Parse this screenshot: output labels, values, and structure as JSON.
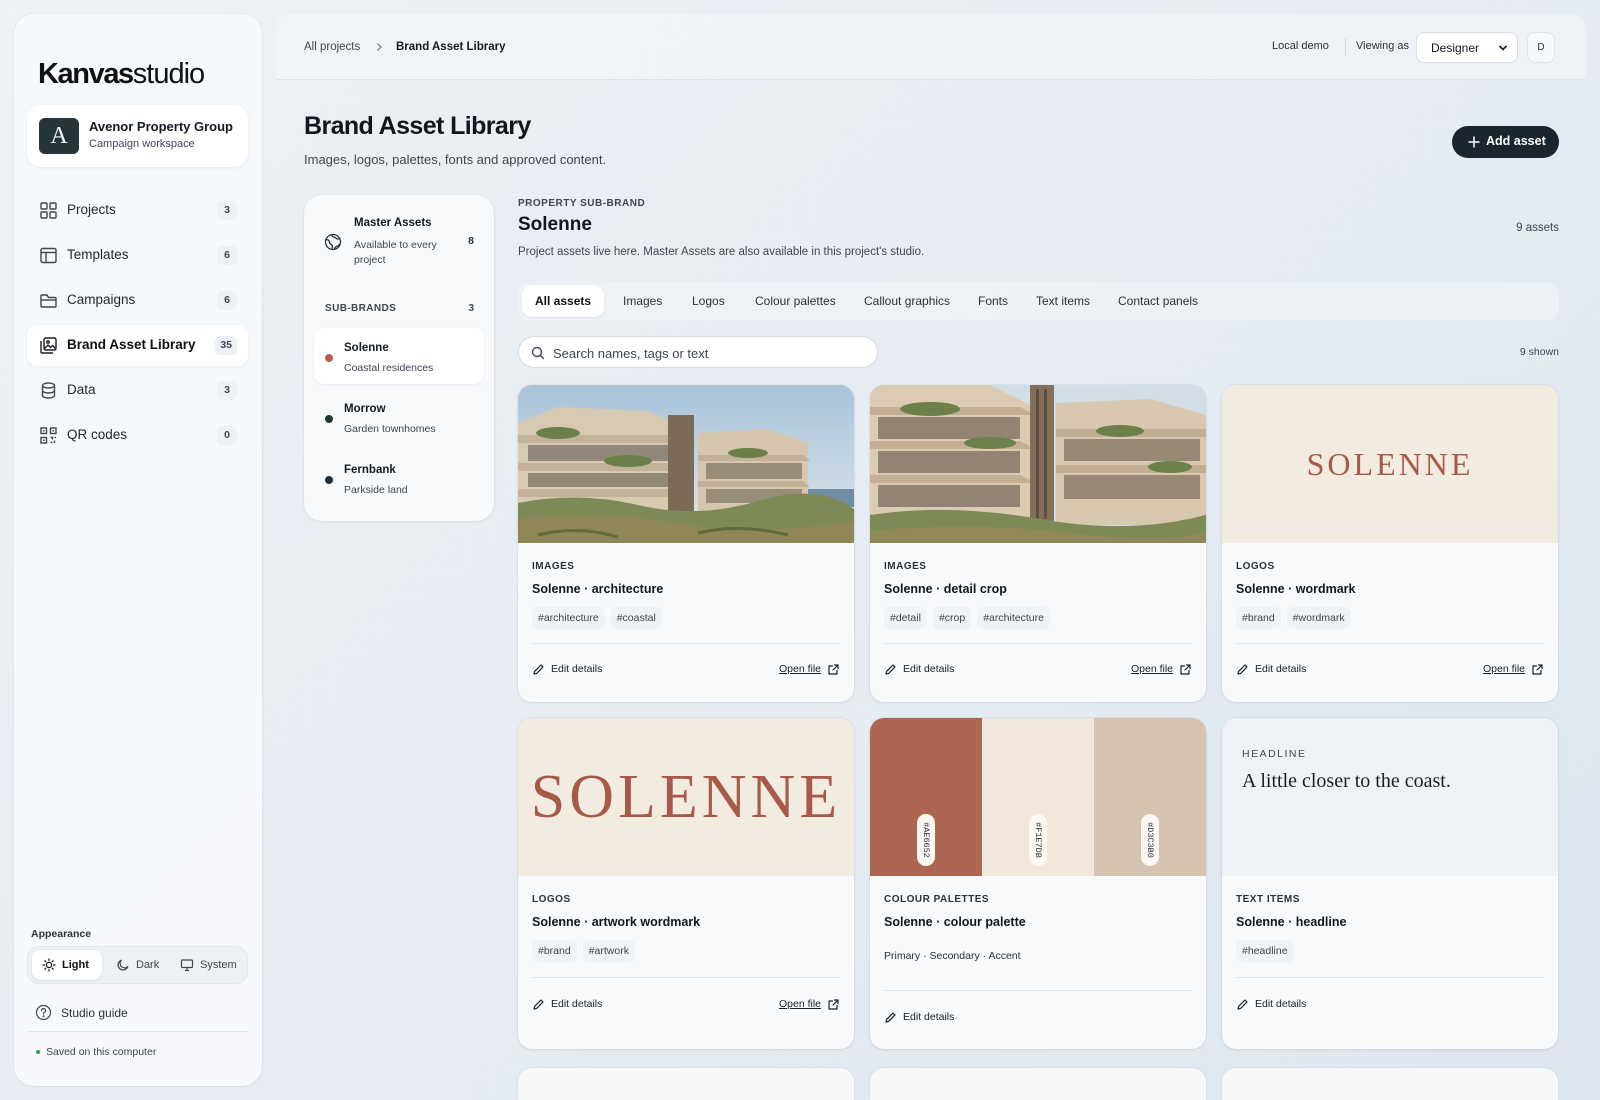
{
  "app": {
    "logo_bold": "Kanvas",
    "logo_light": "studio"
  },
  "workspace": {
    "avatar": "A",
    "name": "Avenor Property Group",
    "subtitle": "Campaign workspace"
  },
  "sidebar": {
    "items": [
      {
        "label": "Projects",
        "count": "3",
        "icon": "grid-icon"
      },
      {
        "label": "Templates",
        "count": "6",
        "icon": "layout-icon"
      },
      {
        "label": "Campaigns",
        "count": "6",
        "icon": "folder-icon"
      },
      {
        "label": "Brand Asset Library",
        "count": "35",
        "icon": "image-library-icon",
        "active": true
      },
      {
        "label": "Data",
        "count": "3",
        "icon": "database-icon"
      },
      {
        "label": "QR codes",
        "count": "0",
        "icon": "qr-code-icon"
      }
    ],
    "appearance_label": "Appearance",
    "themes": [
      "Light",
      "Dark",
      "System"
    ],
    "active_theme": "Light",
    "guide": "Studio guide",
    "saved": "Saved on this computer"
  },
  "topbar": {
    "breadcrumb_root": "All projects",
    "breadcrumb_current": "Brand Asset Library",
    "mode": "Local demo",
    "viewing_label": "Viewing as",
    "role": "Designer",
    "user_initial": "D"
  },
  "page": {
    "title": "Brand Asset Library",
    "subtitle": "Images, logos, palettes, fonts and approved content.",
    "add_button": "Add asset"
  },
  "brand_panel": {
    "master_title": "Master Assets",
    "master_subtitle": "Available to every project",
    "master_count": "8",
    "sub_brands_label": "SUB-BRANDS",
    "sub_brands_count": "3",
    "sub_brands": [
      {
        "name": "Solenne",
        "subtitle": "Coastal residences",
        "color": "#B5604E",
        "active": true
      },
      {
        "name": "Morrow",
        "subtitle": "Garden townhomes",
        "color": "#1E3A2E"
      },
      {
        "name": "Fernbank",
        "subtitle": "Parkside land",
        "color": "#1F2E38"
      }
    ]
  },
  "main": {
    "eyebrow": "PROPERTY SUB-BRAND",
    "title": "Solenne",
    "asset_count": "9 assets",
    "description": "Project assets live here. Master Assets are also available in this project's studio.",
    "tabs": [
      "All assets",
      "Images",
      "Logos",
      "Colour palettes",
      "Callout graphics",
      "Fonts",
      "Text items",
      "Contact panels"
    ],
    "active_tab": "All assets",
    "search_placeholder": "Search names, tags or text",
    "shown_count": "9 shown"
  },
  "assets": [
    {
      "category": "IMAGES",
      "title": "Solenne · architecture",
      "tags": [
        "#architecture",
        "#coastal"
      ],
      "edit": "Edit details",
      "open": "Open file"
    },
    {
      "category": "IMAGES",
      "title": "Solenne · detail crop",
      "tags": [
        "#detail",
        "#crop",
        "#architecture"
      ],
      "edit": "Edit details",
      "open": "Open file"
    },
    {
      "category": "LOGOS",
      "title": "Solenne · wordmark",
      "tags": [
        "#brand",
        "#wordmark"
      ],
      "edit": "Edit details",
      "open": "Open file",
      "logo_text": "SOLENNE"
    },
    {
      "category": "LOGOS",
      "title": "Solenne · artwork wordmark",
      "tags": [
        "#brand",
        "#artwork"
      ],
      "edit": "Edit details",
      "open": "Open file",
      "logo_text": "SOLENNE"
    },
    {
      "category": "COLOUR PALETTES",
      "title": "Solenne · colour palette",
      "subtitle": "Primary · Secondary · Accent",
      "edit": "Edit details",
      "swatches": [
        "#AE6652",
        "#F1E7DB",
        "#D3C3B0"
      ]
    },
    {
      "category": "TEXT ITEMS",
      "title": "Solenne · headline",
      "tags": [
        "#headline"
      ],
      "edit": "Edit details",
      "headline_label": "HEADLINE",
      "headline_text": "A little closer to the coast."
    }
  ],
  "colors": {
    "accent_dark": "#1B2530",
    "brand_terracotta": "#A85A4A",
    "logo_bg": "#F2EBDF",
    "status_saved": "#2F9E62"
  }
}
